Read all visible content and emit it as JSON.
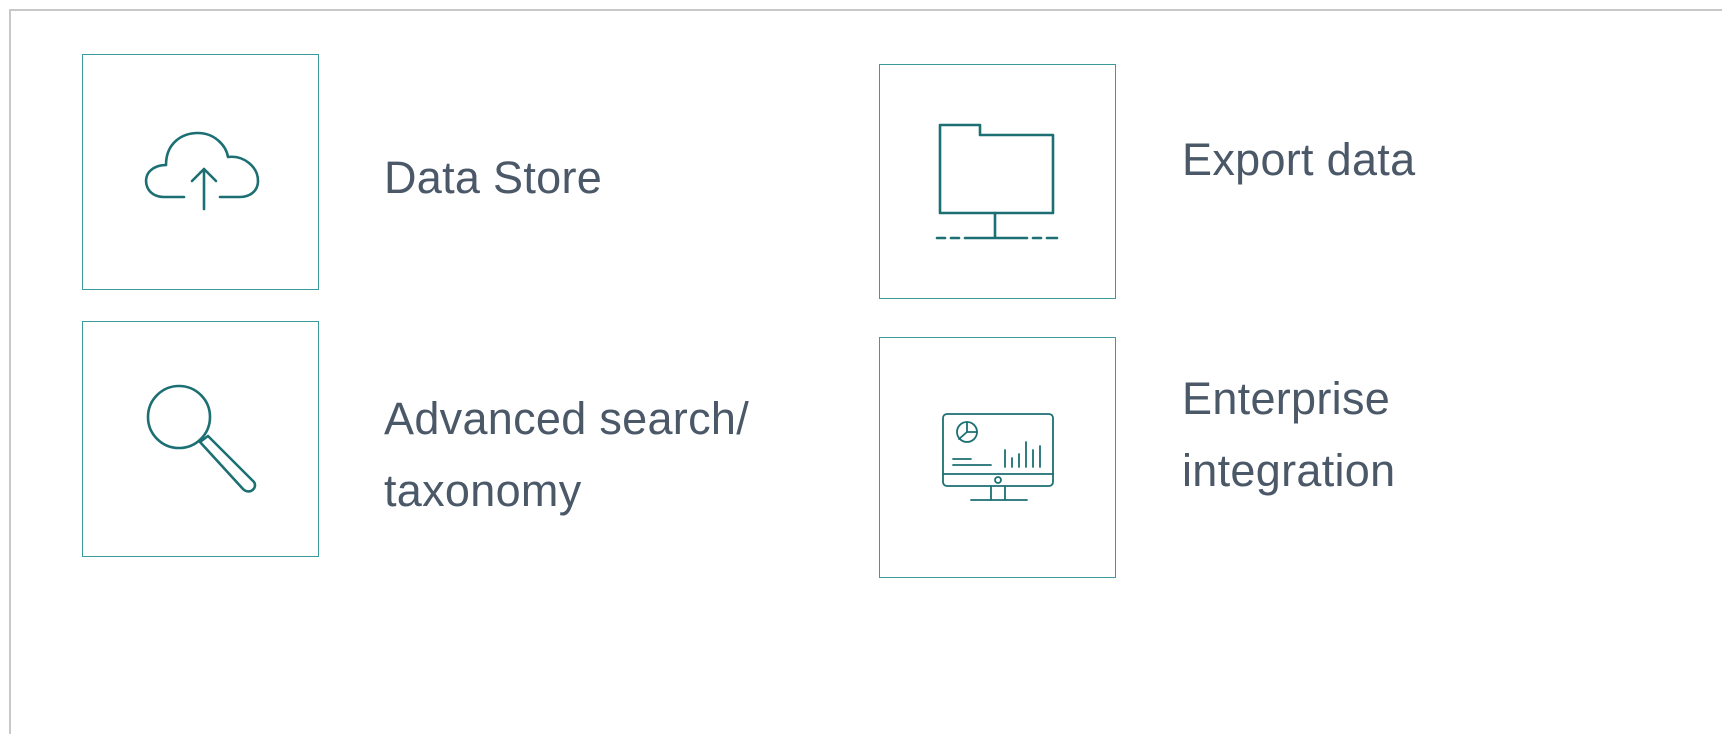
{
  "colors": {
    "tile_border": "#3a9a9c",
    "icon_stroke": "#1c6f72",
    "label_text": "#4a5868",
    "panel_border": "#c8c8c8"
  },
  "features": [
    {
      "id": "data-store",
      "icon": "cloud-upload-icon",
      "label": "Data Store"
    },
    {
      "id": "export-data",
      "icon": "network-folder-icon",
      "label": "Export data"
    },
    {
      "id": "advanced-search",
      "icon": "magnifier-icon",
      "label": "Advanced search/\ntaxonomy"
    },
    {
      "id": "enterprise-integration",
      "icon": "dashboard-monitor-icon",
      "label": "Enterprise\nintegration"
    }
  ]
}
